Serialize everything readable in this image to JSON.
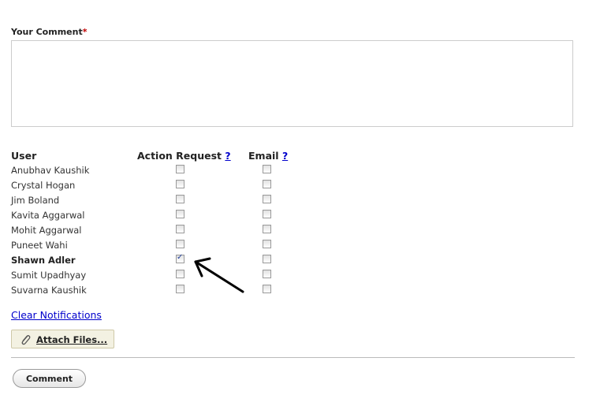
{
  "comment": {
    "label": "Your Comment",
    "required_mark": "*",
    "value": ""
  },
  "table": {
    "headers": {
      "user": "User",
      "action_request": "Action Request",
      "email": "Email",
      "help": "?"
    },
    "rows": [
      {
        "name": "Anubhav Kaushik",
        "bold": false,
        "action_request": false,
        "email": false
      },
      {
        "name": "Crystal Hogan",
        "bold": false,
        "action_request": false,
        "email": false
      },
      {
        "name": "Jim Boland",
        "bold": false,
        "action_request": false,
        "email": false
      },
      {
        "name": "Kavita Aggarwal",
        "bold": false,
        "action_request": false,
        "email": false
      },
      {
        "name": "Mohit Aggarwal",
        "bold": false,
        "action_request": false,
        "email": false
      },
      {
        "name": "Puneet Wahi",
        "bold": false,
        "action_request": false,
        "email": false
      },
      {
        "name": "Shawn Adler",
        "bold": true,
        "action_request": true,
        "email": false
      },
      {
        "name": "Sumit Upadhyay",
        "bold": false,
        "action_request": false,
        "email": false
      },
      {
        "name": "Suvarna Kaushik",
        "bold": false,
        "action_request": false,
        "email": false
      }
    ]
  },
  "clear_notifications": "Clear Notifications",
  "attach": {
    "label": "Attach Files...",
    "icon": "paperclip-icon"
  },
  "submit": {
    "label": "Comment"
  },
  "annotation": {
    "icon": "hand-drawn-arrow-icon",
    "color": "#000000"
  }
}
